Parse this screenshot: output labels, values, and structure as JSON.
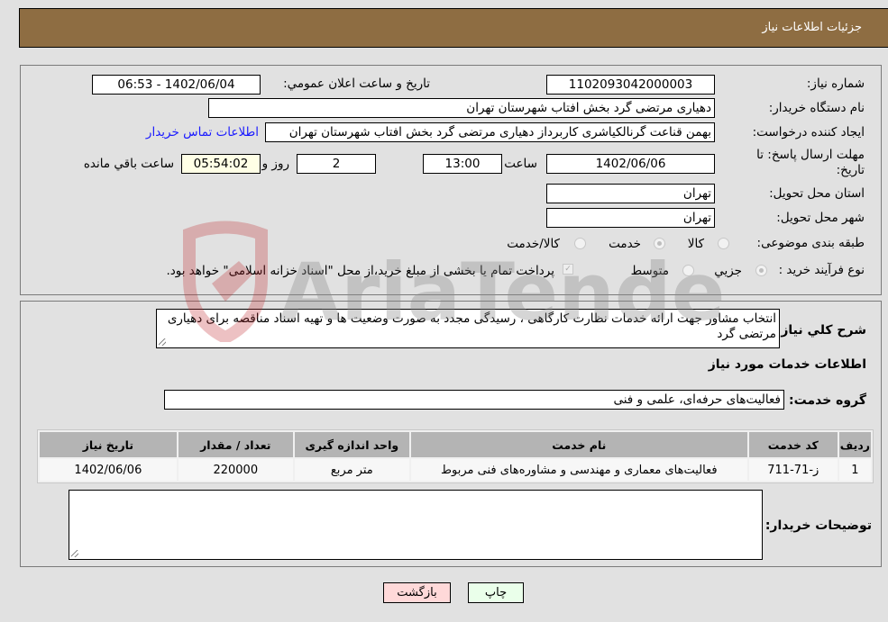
{
  "header": {
    "title": "جزئیات اطلاعات نیاز"
  },
  "details": {
    "need_number_label": "شماره نیاز:",
    "need_number": "1102093042000003",
    "announce_label": "تاریخ و ساعت اعلان عمومي:",
    "announce_value": "1402/06/04 - 06:53",
    "buyer_org_label": "نام دستگاه خریدار:",
    "buyer_org": "دهیاری مرتضی گرد بخش افتاب شهرستان تهران",
    "creator_label": "ایجاد کننده درخواست:",
    "creator": "بهمن قناعت گرنالکیاشری کاربرداز دهیاری مرتضی گرد بخش افتاب شهرستان تهران",
    "contact_link": "اطلاعات تماس خریدار",
    "deadline_label_1": "مهلت ارسال پاسخ: تا",
    "deadline_label_2": "تاریخ:",
    "deadline_date": "1402/06/06",
    "time_label": "ساعت",
    "deadline_time": "13:00",
    "days_value": "2",
    "days_label": "روز و",
    "remaining_time": "05:54:02",
    "remaining_label": "ساعت باقي مانده",
    "province_label": "استان محل تحویل:",
    "province": "تهران",
    "city_label": "شهر محل تحویل:",
    "city": "تهران",
    "category_label": "طبقه بندی موضوعی:",
    "category_options": [
      "کالا",
      "خدمت",
      "کالا/خدمت"
    ],
    "category_selected": "خدمت",
    "process_label": "نوع فرآیند خرید :",
    "process_options": [
      "جزيي",
      "متوسط"
    ],
    "treasury_note": "پرداخت تمام یا بخشی از مبلغ خرید،از محل \"اسناد خزانه اسلامی\" خواهد بود."
  },
  "summary": {
    "description_label": "شرح کلي نياز:",
    "description": "انتخاب مشاور جهت ارائه خدمات نظارت کارگاهی ، رسیدگی مجدد به صورت وضعیت ها و تهیه اسناد مناقصه برای دهیاری مرتضی گرد",
    "services_heading": "اطلاعات خدمات مورد نیاز",
    "service_group_label": "گروه خدمت:",
    "service_group": "فعالیت‌های حرفه‌ای، علمی و فنی"
  },
  "table": {
    "headers": [
      "رديف",
      "کد خدمت",
      "نام خدمت",
      "واحد اندازه گیری",
      "تعداد / مقدار",
      "تاریخ نیاز"
    ],
    "rows": [
      [
        "1",
        "ز-71-711",
        "فعالیت‌های معماری و مهندسی و مشاوره‌های فنی مربوط",
        "متر مربع",
        "220000",
        "1402/06/06"
      ]
    ]
  },
  "buyer_notes": {
    "label": "توضیحات خریدار:",
    "value": ""
  },
  "buttons": {
    "print": "چاپ",
    "back": "بازگشت"
  },
  "watermark": {
    "text": "AriaTender.neT"
  }
}
